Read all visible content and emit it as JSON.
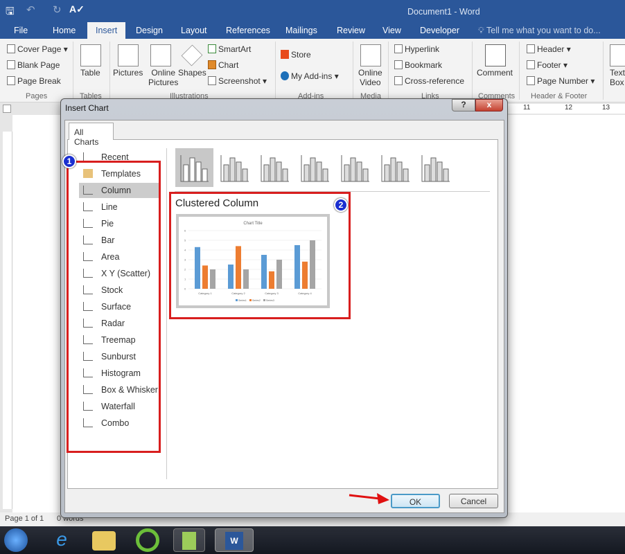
{
  "app": {
    "title": "Document1 - Word"
  },
  "tabs": [
    "File",
    "Home",
    "Insert",
    "Design",
    "Layout",
    "References",
    "Mailings",
    "Review",
    "View",
    "Developer"
  ],
  "tell_me": "Tell me what you want to do...",
  "ribbon": {
    "pages": {
      "cover": "Cover Page",
      "blank": "Blank Page",
      "break": "Page Break",
      "group": "Pages"
    },
    "tables": {
      "table": "Table",
      "group": "Tables"
    },
    "illustrations": {
      "pictures": "Pictures",
      "online1": "Online",
      "online2": "Pictures",
      "shapes": "Shapes",
      "smartart": "SmartArt",
      "chart": "Chart",
      "screenshot": "Screenshot",
      "group": "Illustrations"
    },
    "addins": {
      "store": "Store",
      "myaddins": "My Add-ins",
      "group": "Add-ins"
    },
    "media": {
      "v1": "Online",
      "v2": "Video",
      "group": "Media"
    },
    "links": {
      "hyperlink": "Hyperlink",
      "bookmark": "Bookmark",
      "crossref": "Cross-reference",
      "group": "Links"
    },
    "comments": {
      "comment": "Comment",
      "group": "Comments"
    },
    "hf": {
      "header": "Header",
      "footer": "Footer",
      "pagenum": "Page Number",
      "group": "Header & Footer"
    },
    "text": {
      "t1": "Text",
      "t2": "Box"
    }
  },
  "ruler_labels": [
    "11",
    "12",
    "13"
  ],
  "status": {
    "page": "Page 1 of 1",
    "words": "0 words"
  },
  "dialog": {
    "title": "Insert Chart",
    "help": "?",
    "close": "x",
    "tab": "All Charts",
    "types": [
      {
        "label": "Recent"
      },
      {
        "label": "Templates"
      },
      {
        "label": "Column",
        "selected": true
      },
      {
        "label": "Line"
      },
      {
        "label": "Pie"
      },
      {
        "label": "Bar"
      },
      {
        "label": "Area"
      },
      {
        "label": "X Y (Scatter)"
      },
      {
        "label": "Stock"
      },
      {
        "label": "Surface"
      },
      {
        "label": "Radar"
      },
      {
        "label": "Treemap"
      },
      {
        "label": "Sunburst"
      },
      {
        "label": "Histogram"
      },
      {
        "label": "Box & Whisker"
      },
      {
        "label": "Waterfall"
      },
      {
        "label": "Combo"
      }
    ],
    "subtype_title": "Clustered Column",
    "ok": "OK",
    "cancel": "Cancel",
    "badges": [
      "1",
      "2"
    ]
  },
  "chart_data": {
    "type": "bar",
    "title": "Chart Title",
    "categories": [
      "Category 1",
      "Category 2",
      "Category 3",
      "Category 4"
    ],
    "series": [
      {
        "name": "Series1",
        "values": [
          4.3,
          2.5,
          3.5,
          4.5
        ],
        "color": "#5b9bd5"
      },
      {
        "name": "Series2",
        "values": [
          2.4,
          4.4,
          1.8,
          2.8
        ],
        "color": "#ed7d31"
      },
      {
        "name": "Series3",
        "values": [
          2,
          2,
          3,
          5
        ],
        "color": "#a5a5a5"
      }
    ],
    "ylim": [
      0,
      6
    ],
    "yticks": [
      "0",
      "1",
      "2",
      "3",
      "4",
      "5",
      "6"
    ],
    "grid": true,
    "legend": "bottom"
  },
  "colors": {
    "word_blue": "#2b579a",
    "highlight_red": "#d81e1e",
    "badge_blue": "#1a2fd0"
  }
}
